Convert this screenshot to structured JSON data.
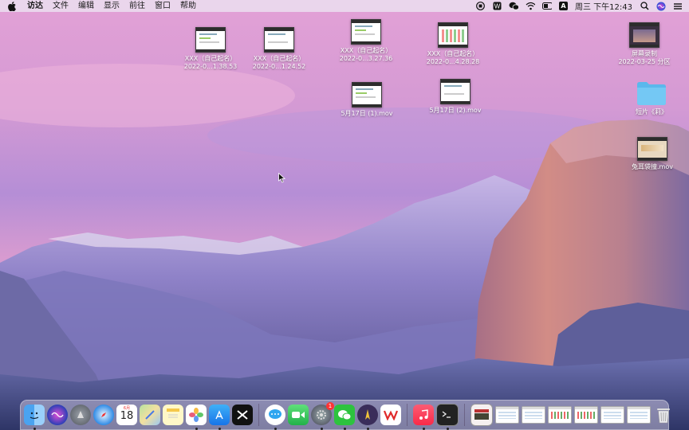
{
  "menubar": {
    "app_name": "访达",
    "items": [
      "文件",
      "编辑",
      "显示",
      "前往",
      "窗口",
      "帮助"
    ],
    "clock": "周三 下午12:43",
    "status_icons": [
      "record-icon",
      "wps-icon",
      "wechat-icon",
      "wifi-icon",
      "battery-icon",
      "input-method-icon",
      "clock",
      "search-icon",
      "siri-icon",
      "control-center-icon"
    ],
    "input_method_label": "A"
  },
  "desktop_icons": [
    {
      "line1": "XXX（自己起名）",
      "line2": "2022-0...1.38.53"
    },
    {
      "line1": "XXX（自己起名）",
      "line2": "2022-0...1.24.52"
    },
    {
      "line1": "XXX（自己起名）",
      "line2": "2022-0...3.27.36"
    },
    {
      "line1": "XXX（自己起名）",
      "line2": "2022-0...4.28.28"
    },
    {
      "line1": "5月17日 (1).mov",
      "line2": ""
    },
    {
      "line1": "5月17日 (2).mov",
      "line2": ""
    },
    {
      "line1": "屏幕录制",
      "line2": "2022-03-25 分区"
    },
    {
      "line1": "短片《莉》",
      "line2": ""
    },
    {
      "line1": "兔耳袋撞.mov",
      "line2": ""
    }
  ],
  "dock": {
    "calendar_month": "6月",
    "calendar_day": "18",
    "system_prefs_badge": "1",
    "apps": [
      "finder-icon",
      "siri-icon",
      "launchpad-icon",
      "safari-icon",
      "calendar-icon",
      "maps-icon",
      "notes-icon",
      "photos-icon",
      "app-store-icon",
      "capcut-icon",
      "messages-icon",
      "facetime-icon",
      "system-preferences-icon",
      "wechat-icon",
      "tampermonkey-icon",
      "wps-icon",
      "music-icon",
      "terminal-icon",
      "video-window-icon",
      "trash-icon"
    ]
  },
  "colors": {
    "sky_top": "#e6a7d9",
    "sky_mid": "#c79bd8",
    "mountain": "#8a7cc0",
    "rock": "#c98a8a"
  }
}
